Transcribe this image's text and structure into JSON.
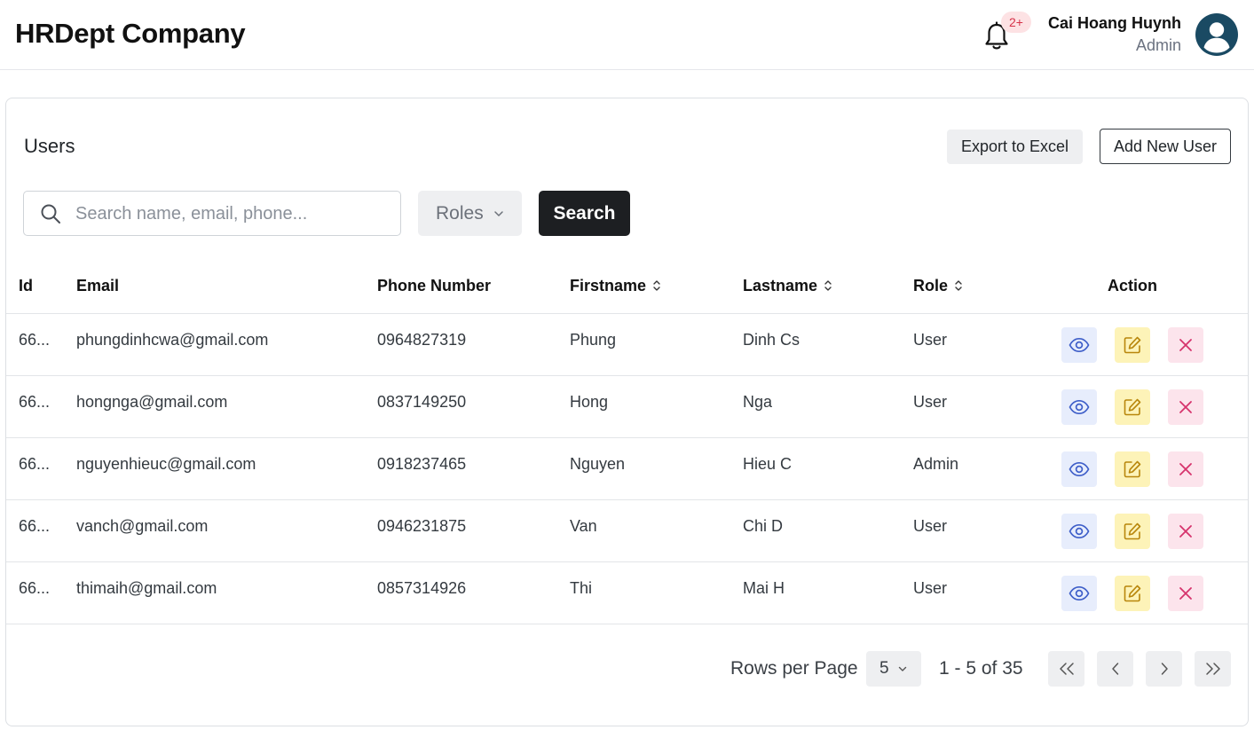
{
  "header": {
    "brand": "HRDept Company",
    "notification_badge": "2+",
    "user_name": "Cai Hoang Huynh",
    "user_role": "Admin"
  },
  "users_card": {
    "title": "Users",
    "export_label": "Export to Excel",
    "add_label": "Add New User"
  },
  "filters": {
    "search_placeholder": "Search name, email, phone...",
    "roles_label": "Roles",
    "search_button": "Search"
  },
  "table": {
    "columns": {
      "id": "Id",
      "email": "Email",
      "phone": "Phone Number",
      "firstname": "Firstname",
      "lastname": "Lastname",
      "role": "Role",
      "action": "Action"
    },
    "rows": [
      {
        "id": "66...",
        "email": "phungdinhcwa@gmail.com",
        "phone": "0964827319",
        "firstname": "Phung",
        "lastname": "Dinh Cs",
        "role": "User"
      },
      {
        "id": "66...",
        "email": "hongnga@gmail.com",
        "phone": "0837149250",
        "firstname": "Hong",
        "lastname": "Nga",
        "role": "User"
      },
      {
        "id": "66...",
        "email": "nguyenhieuc@gmail.com",
        "phone": "0918237465",
        "firstname": "Nguyen",
        "lastname": "Hieu C",
        "role": "Admin"
      },
      {
        "id": "66...",
        "email": "vanch@gmail.com",
        "phone": "0946231875",
        "firstname": "Van",
        "lastname": "Chi D",
        "role": "User"
      },
      {
        "id": "66...",
        "email": "thimaih@gmail.com",
        "phone": "0857314926",
        "firstname": "Thi",
        "lastname": "Mai H",
        "role": "User"
      }
    ]
  },
  "pagination": {
    "rows_per_page_label": "Rows per Page",
    "rows_per_page_value": "5",
    "range_text": "1 - 5 of 35"
  },
  "colors": {
    "view": "#3f5fc9",
    "edit": "#b8860b",
    "delete": "#d6336c"
  }
}
